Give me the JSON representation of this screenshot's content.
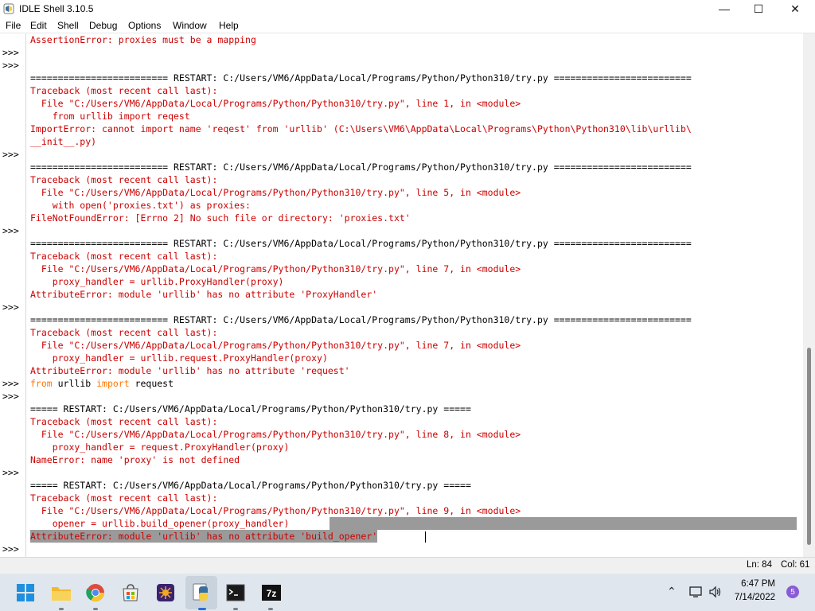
{
  "window": {
    "title": "IDLE Shell 3.10.5",
    "controls": {
      "minimize": "—",
      "maximize": "☐",
      "close": "✕"
    }
  },
  "menu": [
    "File",
    "Edit",
    "Shell",
    "Debug",
    "Options",
    "Window",
    "Help"
  ],
  "shell": {
    "prompt": ">>>",
    "lines": [
      "AssertionError: proxies must be a mapping",
      "",
      "",
      "========================= RESTART: C:/Users/VM6/AppData/Local/Programs/Python/Python310/try.py =========================",
      "Traceback (most recent call last):",
      "  File \"C:/Users/VM6/AppData/Local/Programs/Python/Python310/try.py\", line 1, in <module>",
      "    from urllib import reqest",
      "ImportError: cannot import name 'reqest' from 'urllib' (C:\\Users\\VM6\\AppData\\Local\\Programs\\Python\\Python310\\lib\\urllib\\",
      "__init__.py)",
      "",
      "========================= RESTART: C:/Users/VM6/AppData/Local/Programs/Python/Python310/try.py =========================",
      "Traceback (most recent call last):",
      "  File \"C:/Users/VM6/AppData/Local/Programs/Python/Python310/try.py\", line 5, in <module>",
      "    with open('proxies.txt') as proxies:",
      "FileNotFoundError: [Errno 2] No such file or directory: 'proxies.txt'",
      "",
      "========================= RESTART: C:/Users/VM6/AppData/Local/Programs/Python/Python310/try.py =========================",
      "Traceback (most recent call last):",
      "  File \"C:/Users/VM6/AppData/Local/Programs/Python/Python310/try.py\", line 7, in <module>",
      "    proxy_handler = urllib.ProxyHandler(proxy)",
      "AttributeError: module 'urllib' has no attribute 'ProxyHandler'",
      "",
      "========================= RESTART: C:/Users/VM6/AppData/Local/Programs/Python/Python310/try.py =========================",
      "Traceback (most recent call last):",
      "  File \"C:/Users/VM6/AppData/Local/Programs/Python/Python310/try.py\", line 7, in <module>",
      "    proxy_handler = urllib.request.ProxyHandler(proxy)",
      "AttributeError: module 'urllib' has no attribute 'request'",
      "",
      "",
      "===== RESTART: C:/Users/VM6/AppData/Local/Programs/Python/Python310/try.py =====",
      "Traceback (most recent call last):",
      "  File \"C:/Users/VM6/AppData/Local/Programs/Python/Python310/try.py\", line 8, in <module>",
      "    proxy_handler = request.ProxyHandler(proxy)",
      "NameError: name 'proxy' is not defined",
      "",
      "===== RESTART: C:/Users/VM6/AppData/Local/Programs/Python/Python310/try.py =====",
      "Traceback (most recent call last):",
      "  File \"C:/Users/VM6/AppData/Local/Programs/Python/Python310/try.py\", line 9, in <module>",
      "    opener = urllib.build_opener(proxy_handler)",
      "AttributeError: module 'urllib' has no attribute 'build_opener'",
      ""
    ],
    "input_line": {
      "from": "from",
      "module": " urllib ",
      "import": "import",
      "name": " request"
    }
  },
  "status": {
    "line": "Ln: 84",
    "col": "Col: 61"
  },
  "taskbar": {
    "apps": [
      "start-icon",
      "file-explorer-icon",
      "chrome-icon",
      "store-icon",
      "app-icon",
      "python-idle-icon",
      "terminal-icon",
      "7zip-icon"
    ],
    "time": "6:47 PM",
    "date": "7/14/2022",
    "notifications": "5"
  }
}
